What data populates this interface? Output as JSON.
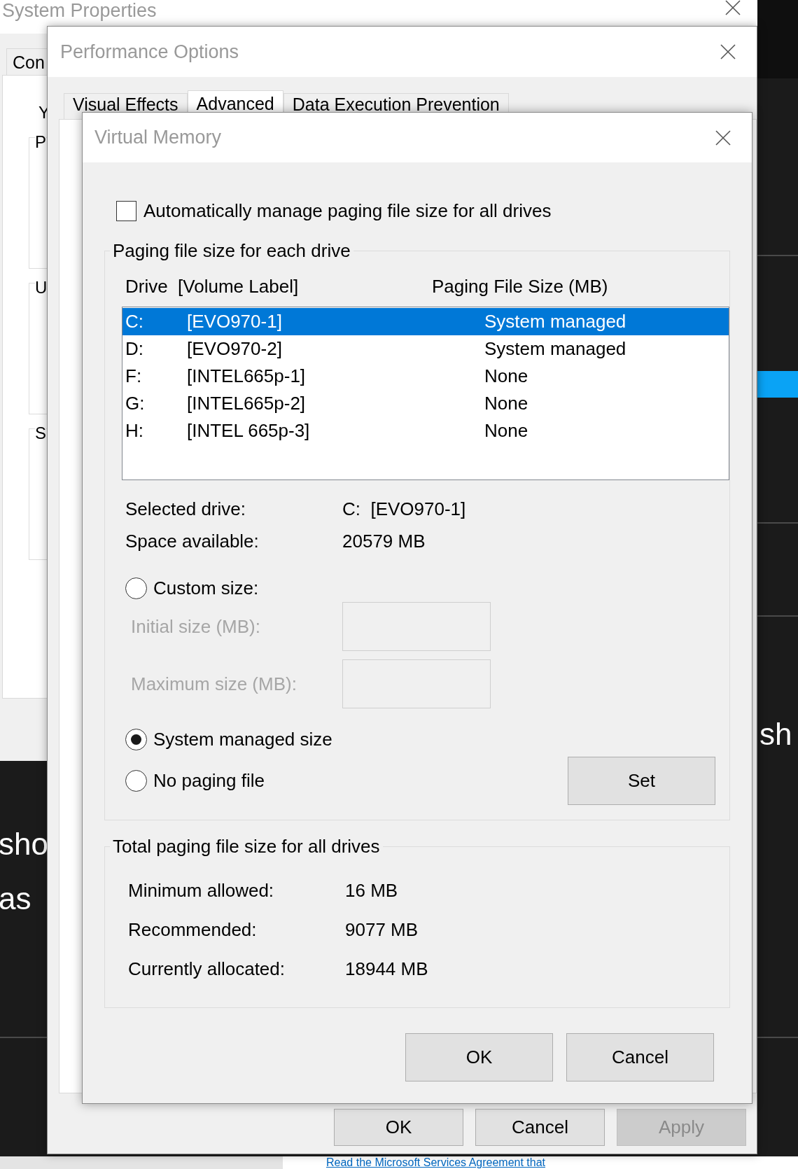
{
  "system_properties": {
    "title": "System Properties",
    "tab": "Con",
    "section_letters": [
      {
        "text": "Y",
        "kind": "text"
      },
      {
        "text": "P",
        "kind": "group"
      },
      {
        "text": "U",
        "kind": "group"
      },
      {
        "text": "S",
        "kind": "group"
      }
    ]
  },
  "performance_options": {
    "title": "Performance Options",
    "tabs": [
      {
        "label": "Visual Effects",
        "selected": false
      },
      {
        "label": "Advanced",
        "selected": true
      },
      {
        "label": "Data Execution Prevention",
        "selected": false
      }
    ],
    "buttons": [
      {
        "label": "OK",
        "disabled": false
      },
      {
        "label": "Cancel",
        "disabled": false
      },
      {
        "label": "Apply",
        "disabled": true
      }
    ]
  },
  "virtual_memory": {
    "title": "Virtual Memory",
    "auto_manage": {
      "label": "Automatically manage paging file size for all drives",
      "checked": false
    },
    "drive_group": {
      "legend": "Paging file size for each drive",
      "columns": [
        "Drive  [Volume Label]",
        "Paging File Size (MB)"
      ],
      "drives": [
        {
          "drive": "C:",
          "volume": "[EVO970-1]",
          "size": "System managed",
          "selected": true
        },
        {
          "drive": "D:",
          "volume": "[EVO970-2]",
          "size": "System managed",
          "selected": false
        },
        {
          "drive": "F:",
          "volume": "[INTEL665p-1]",
          "size": "None",
          "selected": false
        },
        {
          "drive": "G:",
          "volume": "[INTEL665p-2]",
          "size": "None",
          "selected": false
        },
        {
          "drive": "H:",
          "volume": "[INTEL 665p-3]",
          "size": "None",
          "selected": false
        }
      ],
      "info": [
        {
          "label": "Selected drive:",
          "value": "C:  [EVO970-1]"
        },
        {
          "label": "Space available:",
          "value": "20579 MB"
        }
      ],
      "options": [
        {
          "label": "Custom size:",
          "selected": false,
          "fields": [
            {
              "label": "Initial size (MB):",
              "disabled": true
            },
            {
              "label": "Maximum size (MB):",
              "disabled": true
            }
          ]
        },
        {
          "label": "System managed size",
          "selected": true
        },
        {
          "label": "No paging file",
          "selected": false
        }
      ],
      "set_button": "Set"
    },
    "totals_group": {
      "legend": "Total paging file size for all drives",
      "rows": [
        {
          "label": "Minimum allowed:",
          "value": "16 MB"
        },
        {
          "label": "Recommended:",
          "value": "9077 MB"
        },
        {
          "label": "Currently allocated:",
          "value": "18944 MB"
        }
      ]
    },
    "buttons": [
      "OK",
      "Cancel"
    ]
  },
  "background": {
    "left_lines": [
      "sho",
      "as"
    ],
    "right_text": "sh",
    "link": "Read the Microsoft Services Agreement that"
  }
}
